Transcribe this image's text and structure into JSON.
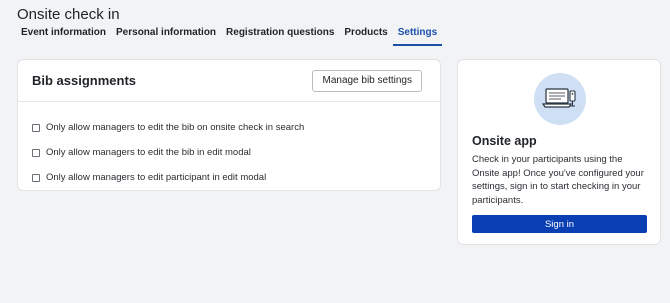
{
  "page": {
    "title": "Onsite check in"
  },
  "tabs": [
    {
      "label": "Event information"
    },
    {
      "label": "Personal information"
    },
    {
      "label": "Registration questions"
    },
    {
      "label": "Products"
    },
    {
      "label": "Settings",
      "active": true
    }
  ],
  "bib": {
    "title": "Bib assignments",
    "manage_button": "Manage bib settings",
    "options": [
      {
        "label": "Only allow managers to edit the bib on onsite check in search",
        "checked": false
      },
      {
        "label": "Only allow managers to edit the bib in edit modal",
        "checked": false
      },
      {
        "label": "Only allow managers to edit participant in edit modal",
        "checked": false
      }
    ]
  },
  "onsite_app": {
    "illustration_icon": "laptop-scanner-icon",
    "title": "Onsite app",
    "description": "Check in your participants using the Onsite app! Once you've configured your settings, sign in to start checking in your participants.",
    "sign_in_button": "Sign in"
  },
  "colors": {
    "accent": "#1d4fa8",
    "primary_button": "#0a3fb3",
    "illustration_bg": "#cfe0f5"
  }
}
